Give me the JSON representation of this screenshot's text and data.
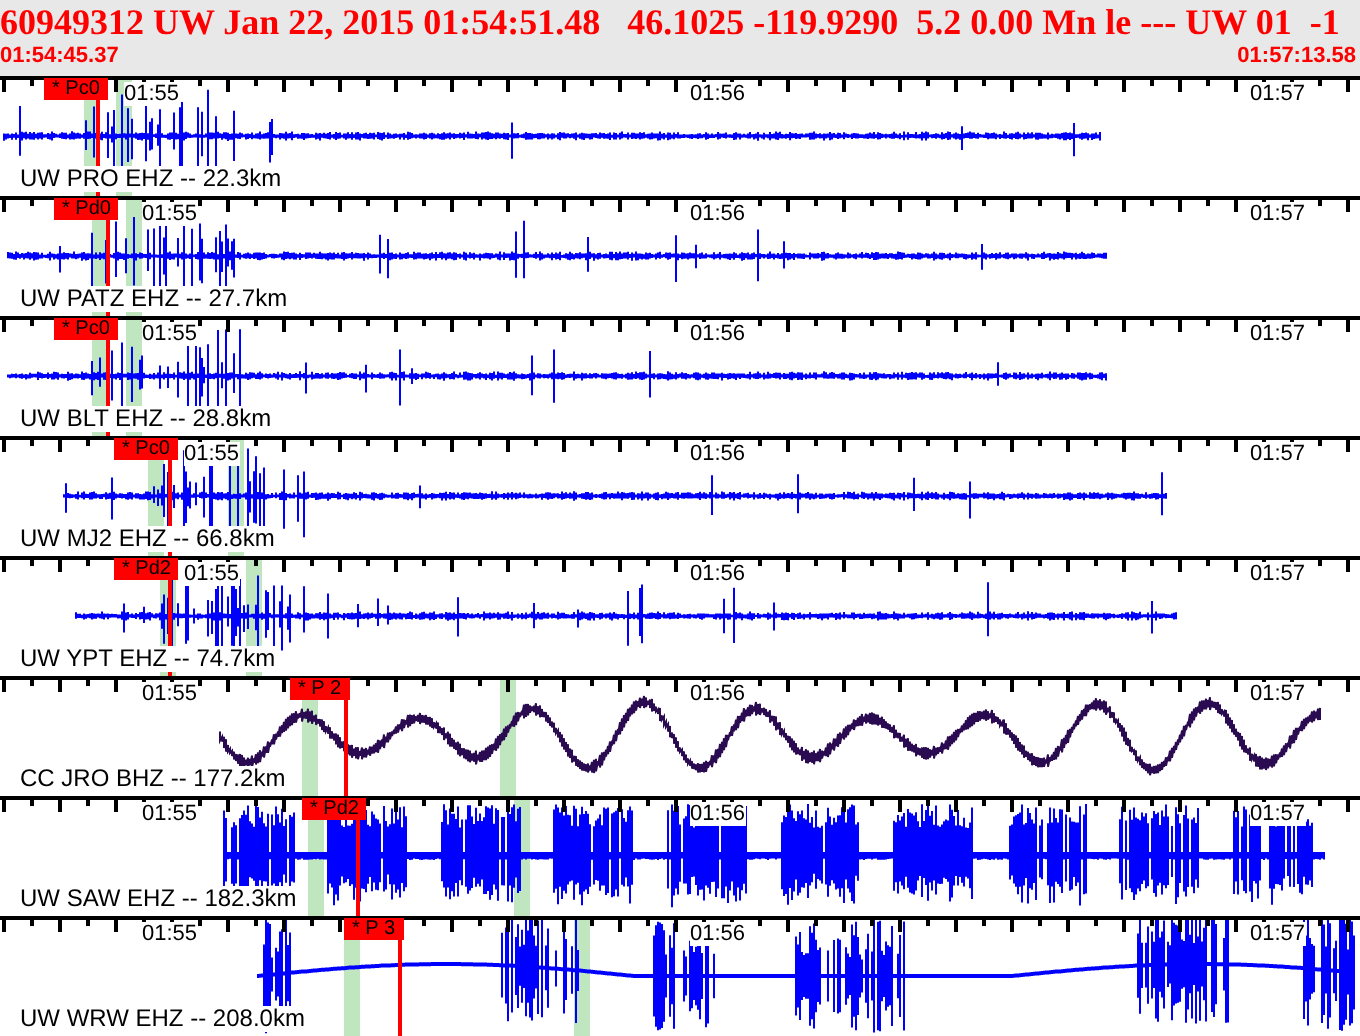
{
  "header": {
    "event_line": "60949312 UW Jan 22, 2015 01:54:51.48   46.1025 -119.9290  5.2 0.00 Mn le --- UW 01  -1",
    "start_time": "01:54:45.37",
    "end_time": "01:57:13.58"
  },
  "channels": [
    {
      "station": "UW PRO EHZ -- 22.3km",
      "kind": "spiky",
      "color": "#0000ff",
      "pick": "* Pc0",
      "time_labels": [
        "01:55",
        "01:56",
        "01:57"
      ]
    },
    {
      "station": "UW PATZ EHZ -- 27.7km",
      "kind": "spiky",
      "color": "#0000ff",
      "pick": "* Pd0",
      "time_labels": [
        "01:55",
        "01:56",
        "01:57"
      ]
    },
    {
      "station": "UW BLT EHZ -- 28.8km",
      "kind": "spiky",
      "color": "#0000ff",
      "pick": "* Pc0",
      "time_labels": [
        "01:55",
        "01:56",
        "01:57"
      ]
    },
    {
      "station": "UW MJ2 EHZ -- 66.8km",
      "kind": "spiky",
      "color": "#0000ff",
      "pick": "* Pc0",
      "time_labels": [
        "01:55",
        "01:56",
        "01:57"
      ]
    },
    {
      "station": "UW YPT EHZ -- 74.7km",
      "kind": "spiky",
      "color": "#0000ff",
      "pick": "* Pd2",
      "time_labels": [
        "01:55",
        "01:56",
        "01:57"
      ]
    },
    {
      "station": "CC JRO BHZ -- 177.2km",
      "kind": "long-period",
      "color": "#2a0a50",
      "pick": "* P 2",
      "time_labels": [
        "01:55",
        "01:56",
        "01:57"
      ]
    },
    {
      "station": "UW SAW EHZ -- 182.3km",
      "kind": "noisy",
      "color": "#0000ff",
      "pick": "* Pd2",
      "time_labels": [
        "01:55",
        "01:56",
        "01:57"
      ]
    },
    {
      "station": "UW WRW EHZ -- 208.0km",
      "kind": "burst",
      "color": "#0000ff",
      "pick": "* P 3",
      "time_labels": [
        "01:55",
        "01:56",
        "01:57"
      ]
    }
  ]
}
